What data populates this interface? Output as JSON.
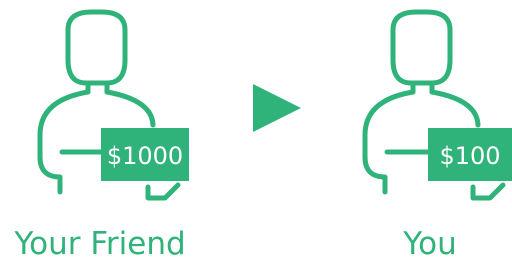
{
  "colors": {
    "accent": "#2fb37a"
  },
  "people": [
    {
      "name": "Your Friend",
      "amount": "$1000"
    },
    {
      "name": "You",
      "amount": "$100"
    }
  ],
  "arrow_icon": "play-triangle"
}
